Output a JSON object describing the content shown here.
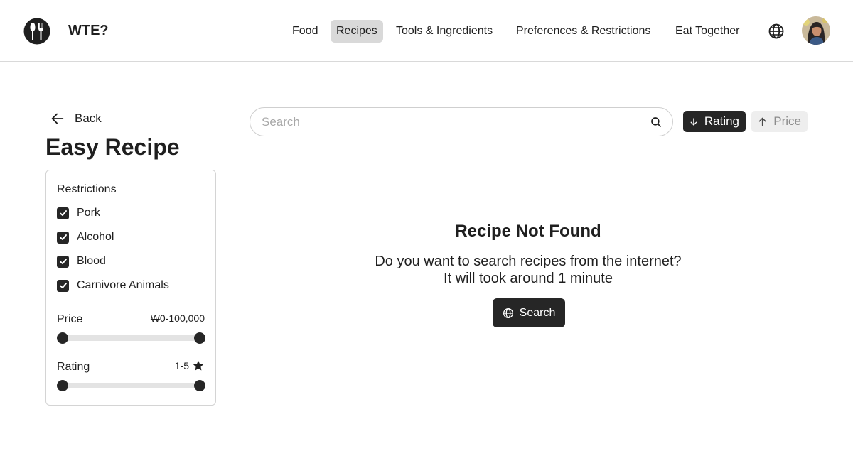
{
  "header": {
    "brand": "WTE?",
    "logo_icon": "fork-spoon-logo",
    "nav": [
      {
        "label": "Food",
        "active": false
      },
      {
        "label": "Recipes",
        "active": true
      },
      {
        "label": "Tools & Ingredients",
        "active": false
      },
      {
        "label": "Preferences & Restrictions",
        "active": false
      },
      {
        "label": "Eat Together",
        "active": false
      }
    ],
    "language_icon": "globe-icon",
    "avatar_icon": "user-avatar"
  },
  "sidebar": {
    "back_label": "Back",
    "title": "Easy Recipe",
    "restrictions_label": "Restrictions",
    "restrictions": [
      {
        "label": "Pork",
        "checked": true
      },
      {
        "label": "Alcohol",
        "checked": true
      },
      {
        "label": "Blood",
        "checked": true
      },
      {
        "label": "Carnivore Animals",
        "checked": true
      }
    ],
    "price": {
      "label": "Price",
      "value": "₩0-100,000",
      "min_fraction": 0,
      "max_fraction": 1
    },
    "rating": {
      "label": "Rating",
      "value": "1-5",
      "icon": "star-icon",
      "min_fraction": 0,
      "max_fraction": 1
    }
  },
  "search": {
    "placeholder": "Search",
    "value": ""
  },
  "sort": {
    "rating_label": "Rating",
    "rating_direction": "down",
    "price_label": "Price",
    "price_direction": "up"
  },
  "empty_state": {
    "title": "Recipe Not Found",
    "line1": "Do you want to search recipes from the internet?",
    "line2": "It will took around 1 minute",
    "button_label": "Search"
  },
  "colors": {
    "primary": "#262626",
    "active_nav_bg": "#d9d9d9",
    "muted": "#8c8c8c",
    "track": "#e3e3e3"
  }
}
